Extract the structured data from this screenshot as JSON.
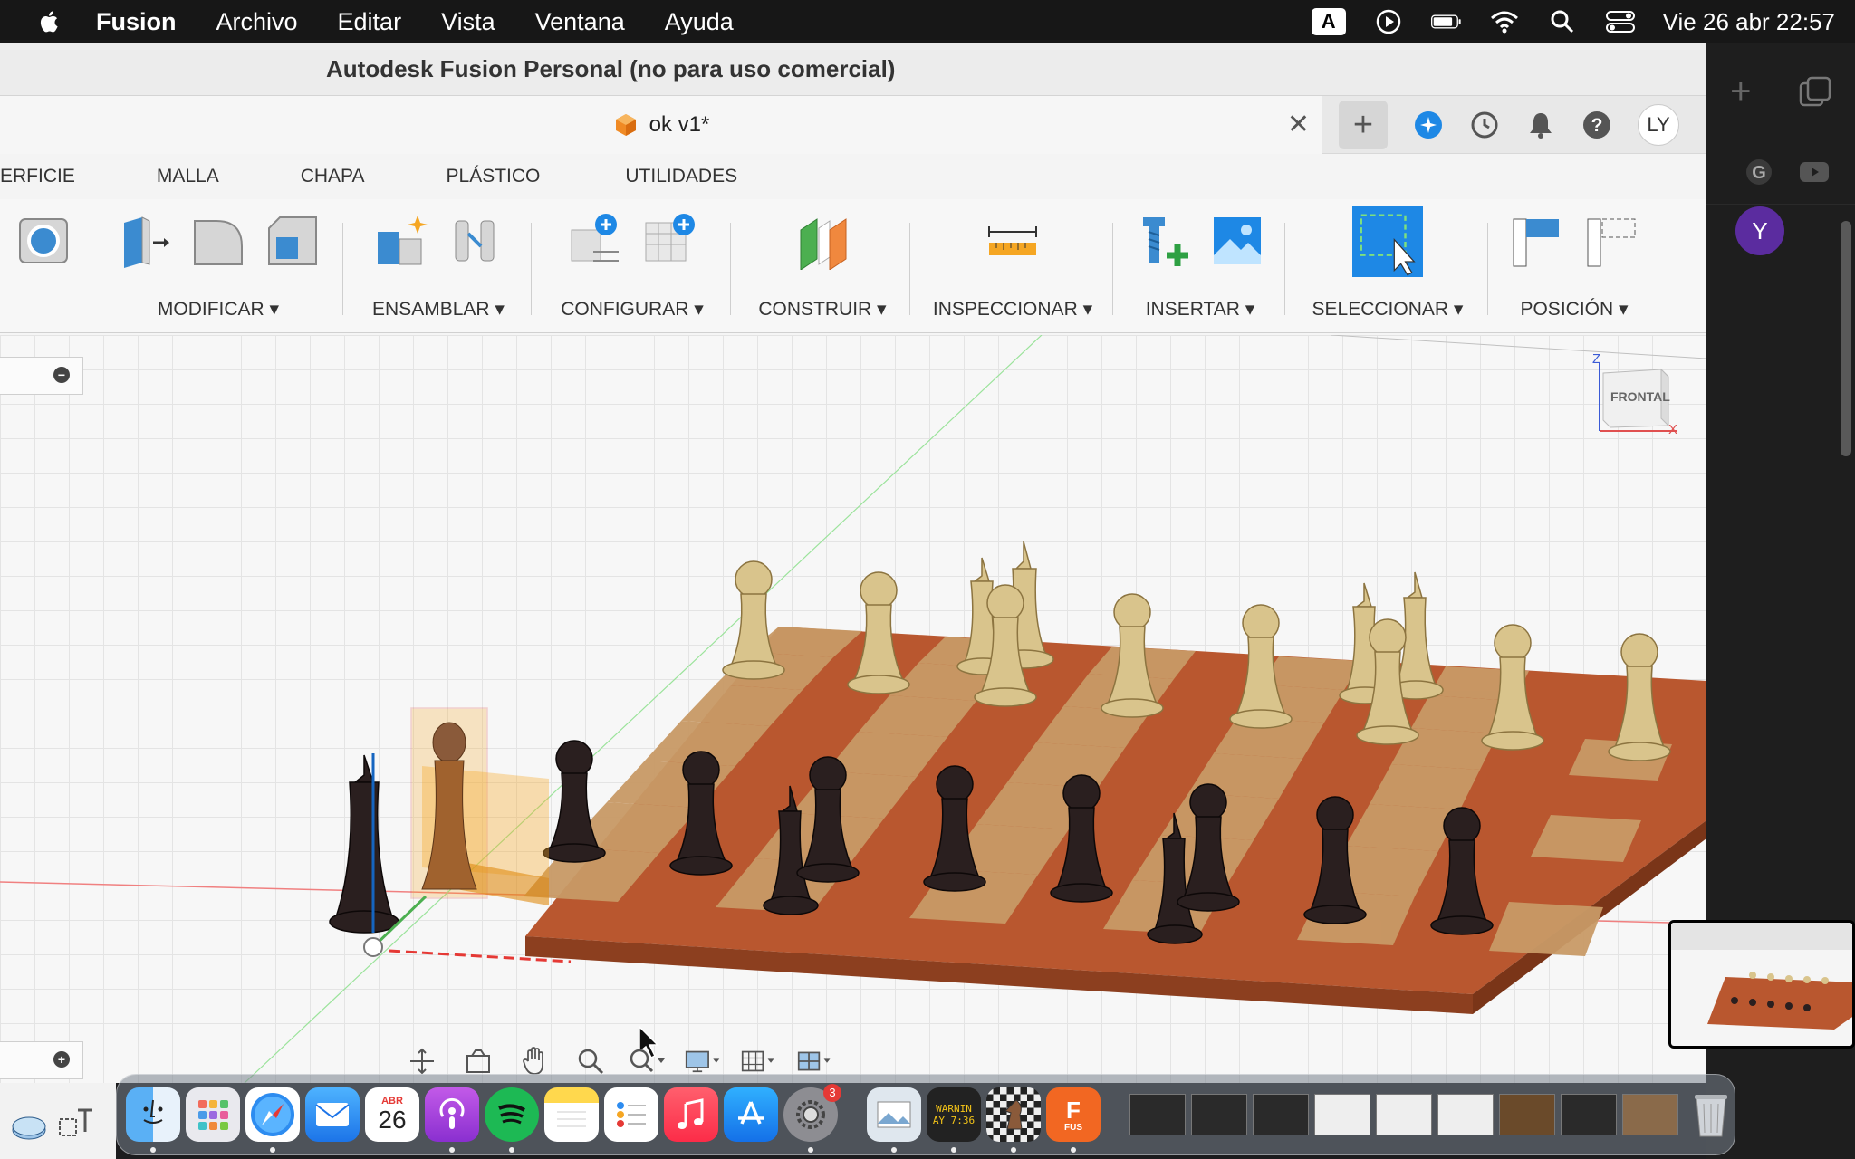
{
  "menubar": {
    "app_name": "Fusion",
    "items": [
      "Archivo",
      "Editar",
      "Vista",
      "Ventana",
      "Ayuda"
    ],
    "keyboard_indicator": "A",
    "datetime": "Vie 26 abr 22:57"
  },
  "window": {
    "title": "Autodesk Fusion Personal (no para uso comercial)"
  },
  "document_tab": {
    "label": "ok v1*",
    "user_initials": "LY"
  },
  "ribbon_tabs": [
    "ERFICIE",
    "MALLA",
    "CHAPA",
    "PLÁSTICO",
    "UTILIDADES"
  ],
  "toolbar_groups": {
    "modify": "MODIFICAR ▾",
    "assemble": "ENSAMBLAR ▾",
    "configure": "CONFIGURAR ▾",
    "construct": "CONSTRUIR ▾",
    "inspect": "INSPECCIONAR ▾",
    "insert": "INSERTAR ▾",
    "select": "SELECCIONAR ▾",
    "position": "POSICIÓN ▾"
  },
  "viewcube": {
    "face": "FRONTAL",
    "axis_z": "Z",
    "axis_x": "X"
  },
  "sidebar": {
    "profile_initial": "Y"
  },
  "dock": {
    "calendar_month": "ABR",
    "calendar_day": "26",
    "settings_badge": "3",
    "console_text_1": "WARNIN",
    "console_text_2": "AY 7:36",
    "fusion_label": "FUS"
  },
  "colors": {
    "accent_blue": "#1e88e5",
    "board_dark": "#b5502f",
    "board_light": "#c79a6a",
    "selection_orange": "#f5a623"
  }
}
